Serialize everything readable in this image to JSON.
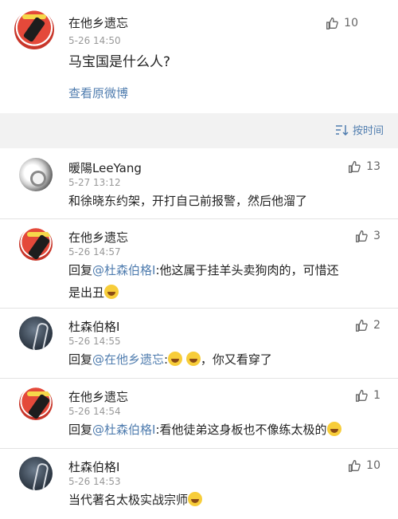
{
  "colors": {
    "link": "#507daf",
    "accent_red": "#e4493a"
  },
  "post": {
    "author": "在他乡遗忘",
    "time": "5-26 14:50",
    "likes": "10",
    "text": "马宝国是什么人?",
    "view_original": "查看原微博"
  },
  "sort_label": "按时间",
  "comments": [
    {
      "author": "暖陽LeeYang",
      "time": "5-27 13:12",
      "likes": "13",
      "text": "和徐晓东约架，开打自己前报警，然后他溜了"
    },
    {
      "author": "在他乡遗忘",
      "time": "5-26 14:57",
      "likes": "3",
      "reply_prefix": "回复",
      "mention": "@杜森伯格I",
      "text_after": ":他这属于挂羊头卖狗肉的，可惜还",
      "text_line2": "是出丑"
    },
    {
      "author": "杜森伯格I",
      "time": "5-26 14:55",
      "likes": "2",
      "reply_prefix": "回复",
      "mention": "@在他乡遗忘",
      "text_after": "，你又看穿了"
    },
    {
      "author": "在他乡遗忘",
      "time": "5-26 14:54",
      "likes": "1",
      "reply_prefix": "回复",
      "mention": "@杜森伯格I",
      "text_after": ":看他徒弟这身板也不像练太极的"
    },
    {
      "author": "杜森伯格I",
      "time": "5-26 14:53",
      "likes": "10",
      "text": "当代著名太极实战宗师"
    }
  ]
}
